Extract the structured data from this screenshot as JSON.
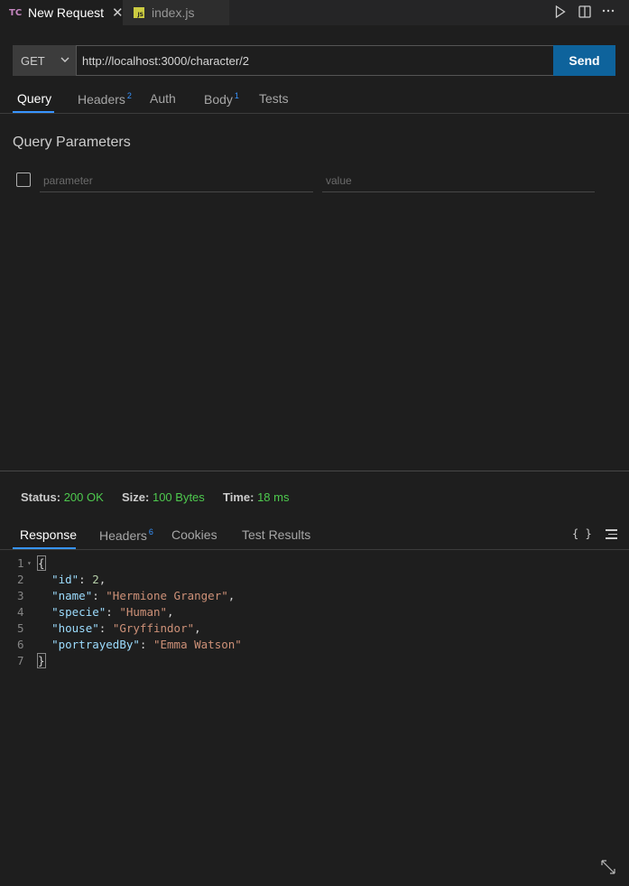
{
  "tabs": [
    {
      "icon": "TC",
      "label": "New Request",
      "close": "✕",
      "active": true
    },
    {
      "icon": "JS",
      "label": "index.js",
      "active": false
    }
  ],
  "request": {
    "method": "GET",
    "url": "http://localhost:3000/character/2",
    "send_label": "Send"
  },
  "request_tabs": [
    {
      "label": "Query",
      "badge": ""
    },
    {
      "label": "Headers",
      "badge": "2"
    },
    {
      "label": "Auth",
      "badge": ""
    },
    {
      "label": "Body",
      "badge": "1"
    },
    {
      "label": "Tests",
      "badge": ""
    }
  ],
  "query": {
    "title": "Query Parameters",
    "param_placeholder": "parameter",
    "value_placeholder": "value"
  },
  "status": {
    "status_label": "Status:",
    "status_value": "200 OK",
    "size_label": "Size:",
    "size_value": "100 Bytes",
    "time_label": "Time:",
    "time_value": "18 ms"
  },
  "response_tabs": [
    {
      "label": "Response",
      "badge": ""
    },
    {
      "label": "Headers",
      "badge": "6"
    },
    {
      "label": "Cookies",
      "badge": ""
    },
    {
      "label": "Test Results",
      "badge": ""
    }
  ],
  "response_tools": {
    "braces": "{ }"
  },
  "response_body": [
    {
      "n": "1",
      "open": "{"
    },
    {
      "n": "2",
      "key": "\"id\"",
      "value": "2",
      "type": "number",
      "comma": ","
    },
    {
      "n": "3",
      "key": "\"name\"",
      "value": "\"Hermione Granger\"",
      "type": "string",
      "comma": ","
    },
    {
      "n": "4",
      "key": "\"specie\"",
      "value": "\"Human\"",
      "type": "string",
      "comma": ","
    },
    {
      "n": "5",
      "key": "\"house\"",
      "value": "\"Gryffindor\"",
      "type": "string",
      "comma": ","
    },
    {
      "n": "6",
      "key": "\"portrayedBy\"",
      "value": "\"Emma Watson\"",
      "type": "string",
      "comma": ""
    },
    {
      "n": "7",
      "close": "}"
    }
  ]
}
